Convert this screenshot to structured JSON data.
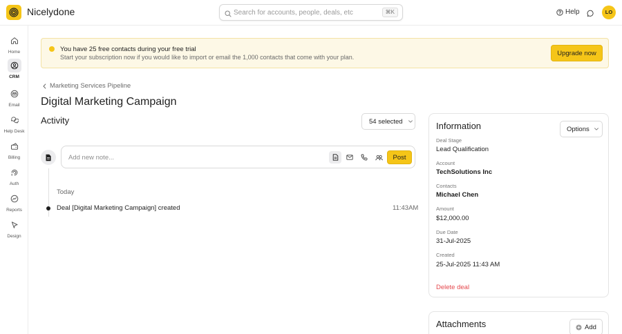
{
  "app": {
    "name": "Nicelydone",
    "logo_icon": "spiral-logo-icon"
  },
  "header": {
    "search_placeholder": "Search for accounts, people, deals, etc",
    "search_shortcut": "⌘K",
    "help_label": "Help",
    "avatar_initials": "LO"
  },
  "sidebar": {
    "items": [
      {
        "label": "Home",
        "icon": "home-icon",
        "active": false
      },
      {
        "label": "CRM",
        "icon": "crm-icon",
        "active": true
      },
      {
        "label": "Email",
        "icon": "email-icon",
        "active": false
      },
      {
        "label": "Help Desk",
        "icon": "help-desk-icon",
        "active": false
      },
      {
        "label": "Billing",
        "icon": "billing-icon",
        "active": false
      },
      {
        "label": "Auth",
        "icon": "auth-icon",
        "active": false
      },
      {
        "label": "Reports",
        "icon": "reports-icon",
        "active": false
      },
      {
        "label": "Design",
        "icon": "design-icon",
        "active": false
      }
    ]
  },
  "banner": {
    "title": "You have 25 free contacts during your free trial",
    "subtitle": "Start your subscription now if you would like to import or email the 1,000 contacts that come with your plan.",
    "button": "Upgrade now"
  },
  "breadcrumb": {
    "label": "Marketing Services Pipeline"
  },
  "page": {
    "title": "Digital Marketing Campaign"
  },
  "activity": {
    "title": "Activity",
    "selected_label": "54 selected",
    "composer_placeholder": "Add new note...",
    "post_button": "Post",
    "group_label": "Today",
    "events": [
      {
        "text": "Deal [Digital Marketing Campaign] created",
        "time": "11:43AM"
      }
    ]
  },
  "information": {
    "title": "Information",
    "options_button": "Options",
    "fields": [
      {
        "label": "Deal Stage",
        "value": "Lead Qualification",
        "bold": false
      },
      {
        "label": "Account",
        "value": "TechSolutions Inc",
        "bold": true
      },
      {
        "label": "Contacts",
        "value": "Michael Chen",
        "bold": true
      },
      {
        "label": "Amount",
        "value": "$12,000.00",
        "bold": false
      },
      {
        "label": "Due Date",
        "value": "31-Jul-2025",
        "bold": false
      },
      {
        "label": "Created",
        "value": "25-Jul-2025 11:43 AM",
        "bold": false
      }
    ],
    "delete_label": "Delete deal"
  },
  "attachments": {
    "title": "Attachments",
    "add_button": "Add"
  },
  "colors": {
    "accent": "#f5c518",
    "danger": "#e5484d",
    "banner_bg": "#fdf8e6"
  }
}
